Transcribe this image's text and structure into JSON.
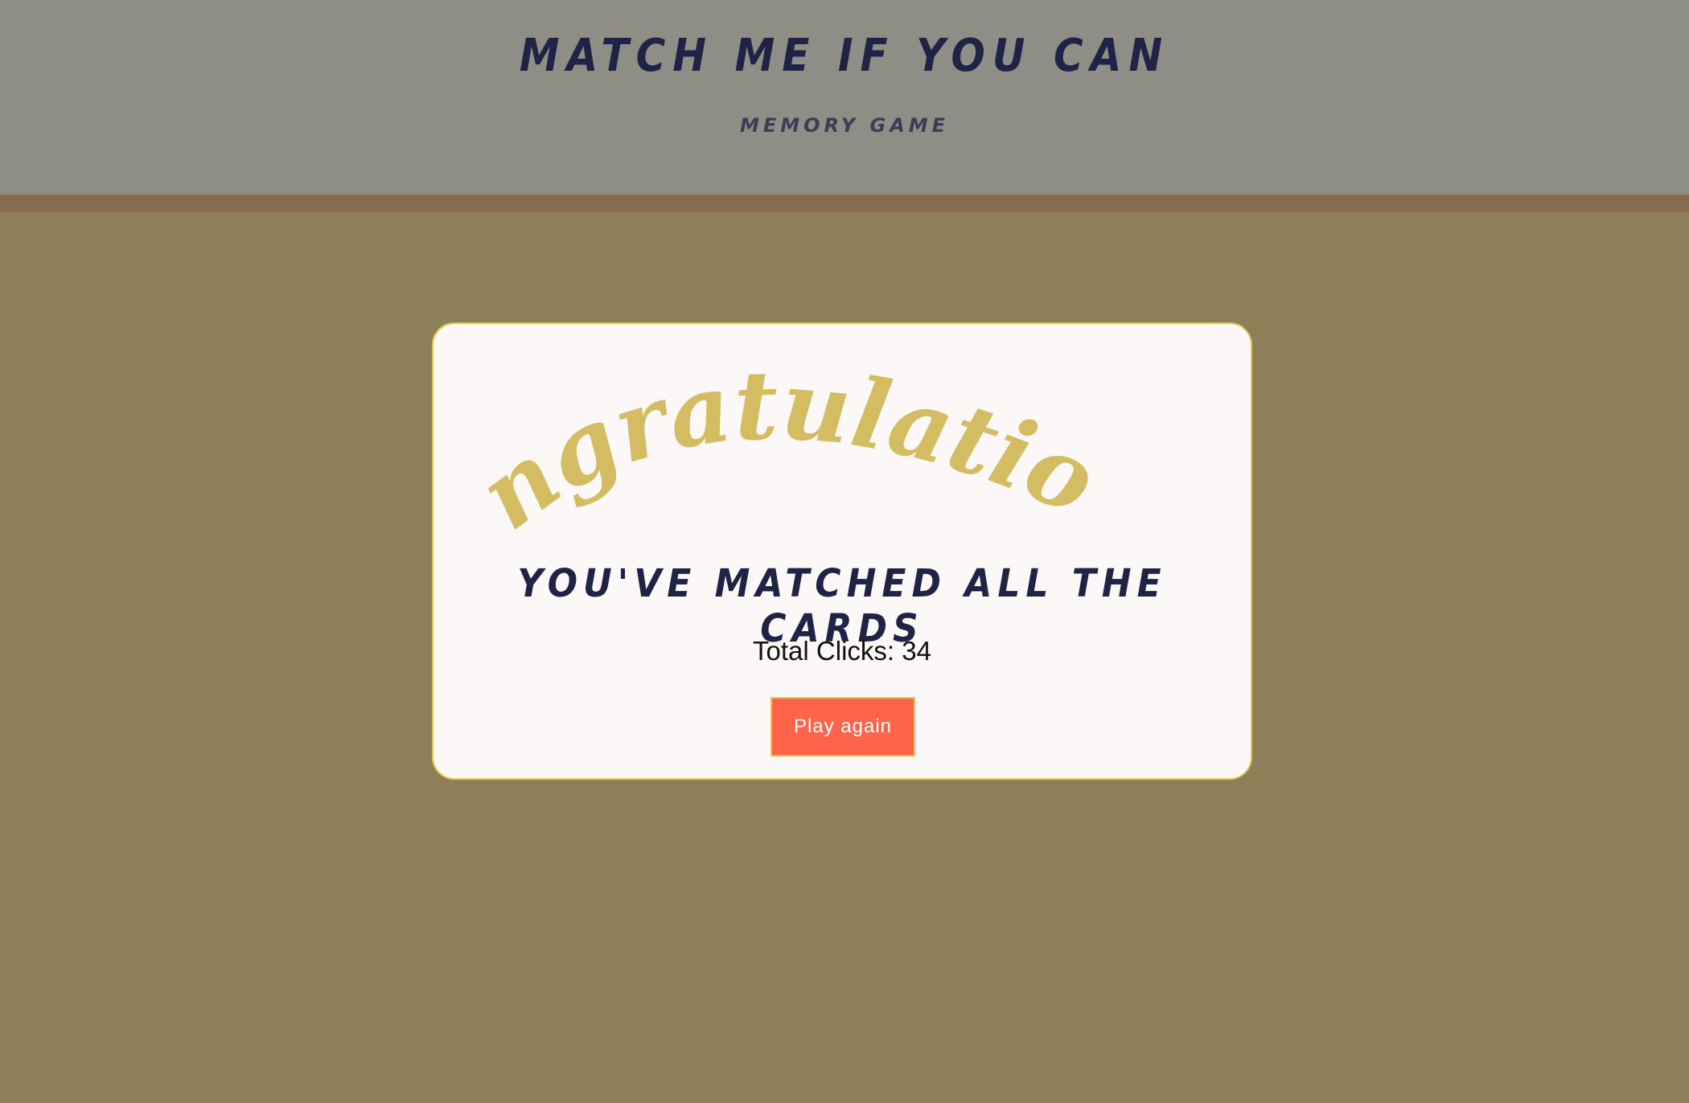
{
  "header": {
    "title": "Match me if you can",
    "subtitle": "Memory game"
  },
  "modal": {
    "heading": "Congratulations!",
    "message": "You've matched all the cards",
    "clicks_label": "Total Clicks:",
    "clicks_value": "34",
    "play_again_label": "Play again"
  },
  "colors": {
    "header_bg": "#8e8d86",
    "stripe": "#896b52",
    "page_bg": "#8d8058",
    "title_text": "#1f2345",
    "congrats_text": "#d4bc62",
    "modal_bg": "#fcf8f8",
    "modal_border": "#e3c64e",
    "button_bg": "#fd6449"
  }
}
